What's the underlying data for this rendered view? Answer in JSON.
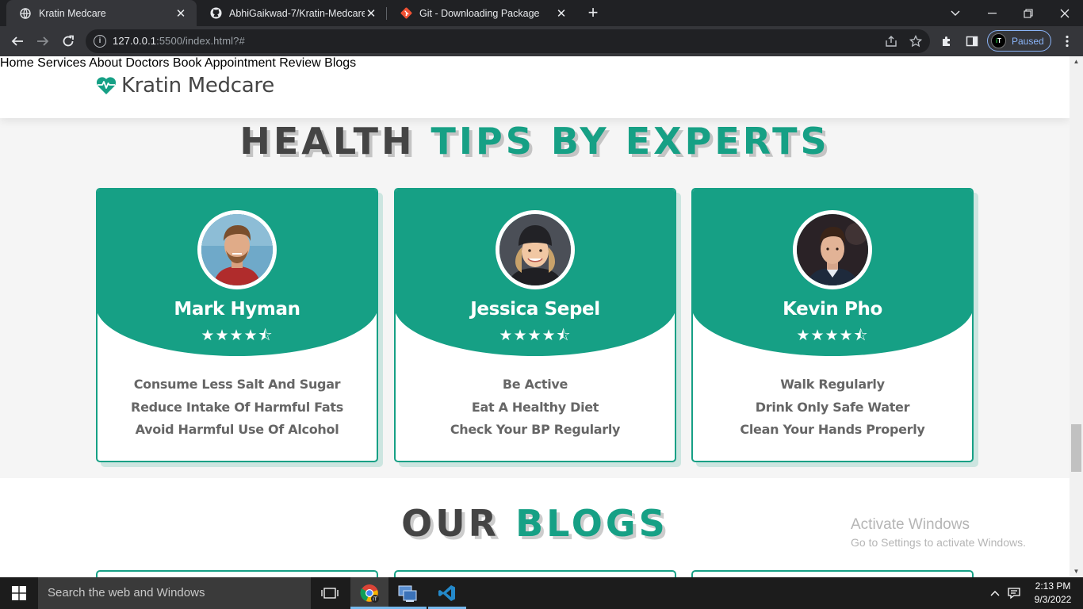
{
  "browser": {
    "tabs": [
      {
        "title": "Kratin Medcare",
        "active": true
      },
      {
        "title": "AbhiGaikwad-7/Kratin-Medcare",
        "active": false
      },
      {
        "title": "Git - Downloading Package",
        "active": false
      }
    ],
    "url_host": "127.0.0.1",
    "url_path": ":5500/index.html?#",
    "profile_status": "Paused"
  },
  "site": {
    "logo": "Kratin Medcare",
    "nav": [
      "Home",
      "Services",
      "About",
      "Doctors",
      "Book Appointment",
      "Review",
      "Blogs"
    ]
  },
  "tips_section": {
    "heading_dark": "HEALTH",
    "heading_accent": "TIPS BY EXPERTS",
    "cards": [
      {
        "name": "Mark Hyman",
        "rating": 4.5,
        "stars": "★★★★⯪",
        "tips": [
          "Consume Less Salt And Sugar",
          "Reduce Intake Of Harmful Fats",
          "Avoid Harmful Use Of Alcohol"
        ]
      },
      {
        "name": "Jessica Sepel",
        "rating": 4.5,
        "stars": "★★★★⯪",
        "tips": [
          "Be Active",
          "Eat A Healthy Diet",
          "Check Your BP Regularly"
        ]
      },
      {
        "name": "Kevin Pho",
        "rating": 4.5,
        "stars": "★★★★⯪",
        "tips": [
          "Walk Regularly",
          "Drink Only Safe Water",
          "Clean Your Hands Properly"
        ]
      }
    ]
  },
  "blogs_section": {
    "heading_dark": "OUR",
    "heading_accent": "BLOGS"
  },
  "activation": {
    "title": "Activate Windows",
    "subtitle": "Go to Settings to activate Windows."
  },
  "taskbar": {
    "search_placeholder": "Search the web and Windows",
    "time": "2:13 PM",
    "date": "9/3/2022"
  },
  "colors": {
    "accent": "#16a085",
    "heading_dark": "#444444",
    "chrome_dark": "#202124"
  }
}
